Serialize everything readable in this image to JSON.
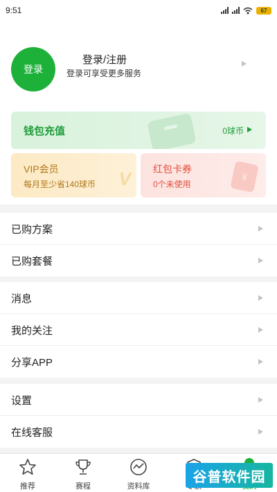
{
  "status_bar": {
    "time": "9:51",
    "battery": "67"
  },
  "profile": {
    "avatar_label": "登录",
    "title": "登录/注册",
    "subtitle": "登录可享受更多服务"
  },
  "wallet": {
    "title": "钱包充值",
    "coins": "0球币"
  },
  "vip": {
    "title": "VIP会员",
    "subtitle": "每月至少省140球币"
  },
  "coupon": {
    "title": "红包卡券",
    "subtitle": "0个未使用"
  },
  "menu_groups": [
    [
      "已购方案",
      "已购套餐"
    ],
    [
      "消息",
      "我的关注",
      "分享APP"
    ],
    [
      "设置",
      "在线客服"
    ]
  ],
  "bottom_nav": [
    {
      "label": "推荐",
      "icon": "star-icon"
    },
    {
      "label": "赛程",
      "icon": "trophy-icon"
    },
    {
      "label": "资料库",
      "icon": "trend-icon"
    },
    {
      "label": "专家",
      "icon": "expert-shield-icon"
    },
    {
      "label": "我的",
      "icon": "me-icon",
      "active": true
    }
  ],
  "watermark": "谷普软件园",
  "colors": {
    "brand_green": "#1db13a",
    "vip_gold": "#b07719",
    "coupon_red": "#e2503d"
  }
}
